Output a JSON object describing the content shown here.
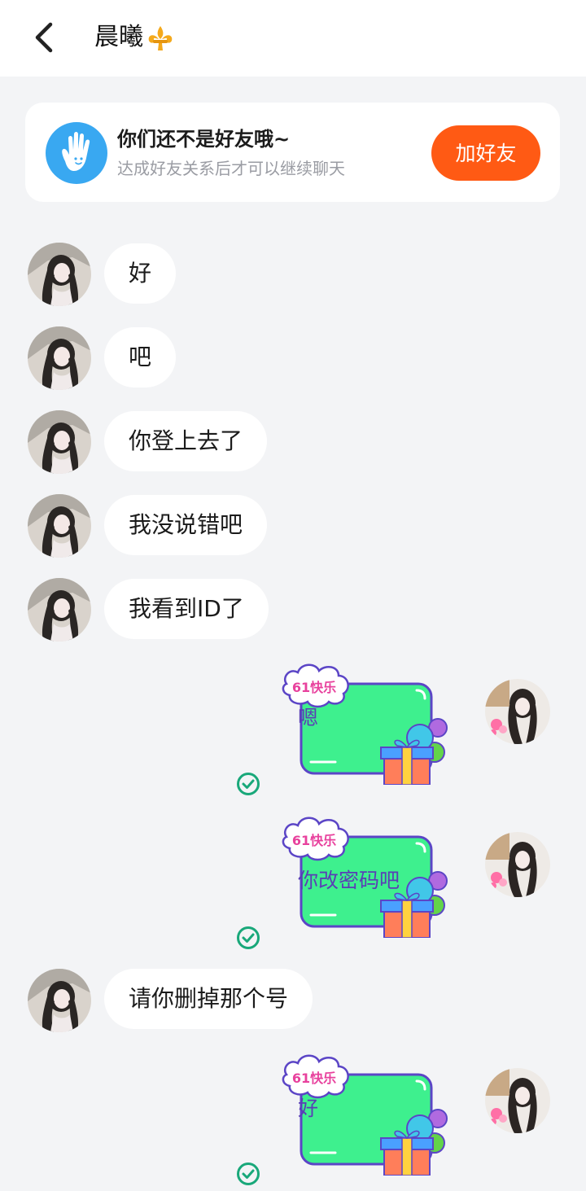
{
  "header": {
    "title": "晨曦",
    "back_icon": "chevron-left-icon",
    "title_badge_icon": "fleur-de-lis-icon",
    "badge_color": "#f4a91c"
  },
  "banner": {
    "icon": "hand-wave-icon",
    "icon_color": "#39a8f1",
    "title": "你们还不是好友哦~",
    "subtitle": "达成好友关系后才可以继续聊天",
    "button_label": "加好友",
    "button_color": "#ff5a14"
  },
  "sticker": {
    "badge": "61快乐",
    "frame_color": "#3ef08e"
  },
  "messages": [
    {
      "side": "left",
      "text": "好"
    },
    {
      "side": "left",
      "text": "吧"
    },
    {
      "side": "left",
      "text": "你登上去了"
    },
    {
      "side": "left",
      "text": "我没说错吧"
    },
    {
      "side": "left",
      "text": "我看到ID了"
    },
    {
      "side": "right",
      "text": "嗯",
      "status": "read"
    },
    {
      "side": "right",
      "text": "你改密码吧",
      "status": "read"
    },
    {
      "side": "left",
      "text": "请你删掉那个号"
    },
    {
      "side": "right",
      "text": "好",
      "status": "read"
    }
  ],
  "status_icon": "check-circle-icon",
  "status_color": "#19a87a"
}
